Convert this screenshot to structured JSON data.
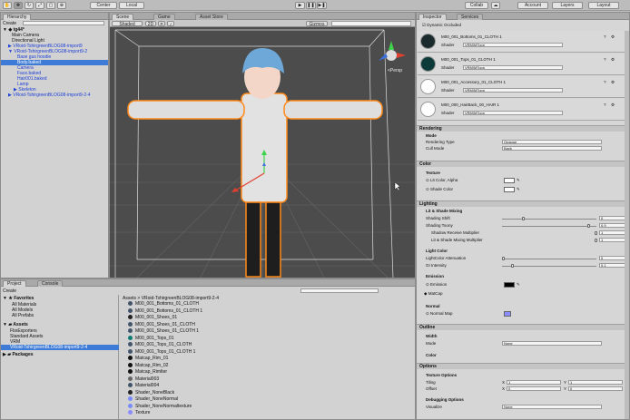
{
  "toolbar": {
    "center": "Center",
    "local": "Local",
    "collab": "Collab",
    "account": "Account",
    "layers": "Layers",
    "layout": "Layout"
  },
  "hierarchy": {
    "tab": "Hierarchy",
    "create": "Create",
    "root": "tg44*",
    "items": [
      "Main Camera",
      "Directional Light",
      "VRoid-TshirgreenBLOG08-import9",
      "VRoid-TshirgreenBLOG08-import9-2",
      "Base gus hoodie",
      "Body.baked",
      "Camera",
      "Face.baked",
      "Hair001.baked",
      "Lamp",
      "Skeleton",
      "VRoid-TshirgreenBLOG08-import9-2-4"
    ]
  },
  "scene": {
    "tabs": [
      "Scene",
      "Game",
      "Asset Store"
    ],
    "shaded": "Shaded",
    "mode2d": "2D",
    "gizmos": "Gizmos",
    "persp": "<Persp"
  },
  "project": {
    "tabs": [
      "Project",
      "Console"
    ],
    "create": "Create",
    "favorites": "Favorites",
    "fav_items": [
      "All Materials",
      "All Models",
      "All Prefabs"
    ],
    "assets": "Assets",
    "asset_items": [
      "FbxExporters",
      "Standard Assets",
      "VRM",
      "VRoid-TshirgreenBLOG08-import9-2-4"
    ],
    "packages": "Packages",
    "breadcrumb": "Assets > VRoid-TshirgreenBLOG08-import9-2-4",
    "files": [
      "M00_001_Bottoms_01_CLOTH",
      "M00_001_Bottoms_01_CLOTH 1",
      "M00_001_Shoes_01",
      "M00_001_Shoes_01_CLOTH",
      "M00_001_Shoes_01_CLOTH 1",
      "M00_001_Tops_01",
      "M00_001_Tops_01_CLOTH",
      "M00_001_Tops_01_CLOTH 1",
      "Matcap_Rim_01",
      "Matcap_Rim_02",
      "Matcap_Rimlter",
      "Material003",
      "Material004",
      "Shader_NoneBlack",
      "Shader_NoneNormal",
      "Shader_NoneNormaltexture",
      "Texture"
    ]
  },
  "inspector": {
    "tabs": [
      "Inspector",
      "Services"
    ],
    "dynamic_occluded": "Dynamic Occluded",
    "materials": [
      {
        "name": "M00_001_Bottoms_01_CLOTH 1",
        "shader": "VRM/MToon"
      },
      {
        "name": "M00_001_Tops_01_CLOTH 1",
        "shader": "VRM/MToon"
      },
      {
        "name": "M00_001_Accessory_01_CLOTH 1",
        "shader": "VRM/MToon"
      },
      {
        "name": "M00_000_HairBack_00_HAIR 1",
        "shader": "VRM/MToon"
      }
    ],
    "shader_label": "Shader",
    "rendering": "Rendering",
    "mode": "Mode",
    "rendering_type": "Rendering Type",
    "rendering_type_val": "Opaque",
    "cull_mode": "Cull Mode",
    "cull_mode_val": "Back",
    "color": "Color",
    "texture": "Texture",
    "lit_color": "Lit Color, Alpha",
    "shade_color": "Shade Color",
    "lighting": "Lighting",
    "lit_shade": "Lit & Shade Mixing",
    "shading_shift": "Shading Shift",
    "shading_shift_val": "0",
    "shading_toony": "Shading Toony",
    "shading_toony_val": "0.9",
    "shadow_recv": "Shadow Receive Multiplier",
    "shadow_recv_val": "1",
    "lit_mix": "Lit & Shade Mixing Multiplier",
    "lit_mix_val": "1",
    "light_color": "Light Color",
    "lc_atten": "LightColor Attenuation",
    "lc_atten_val": "0",
    "gi": "GI Intensity",
    "gi_val": "0.1",
    "emission": "Emission",
    "emission_lbl": "Emission",
    "matcap": "MatCap",
    "normal": "Normal",
    "normal_map": "Normal Map",
    "outline": "Outline",
    "width": "Width",
    "mode2": "Mode",
    "mode2_val": "None",
    "color2": "Color",
    "options": "Options",
    "tex_options": "Texture Options",
    "tiling": "Tiling",
    "offset": "Offset",
    "x": "X",
    "y": "Y",
    "tx": "1",
    "ty": "1",
    "ox": "0",
    "oy": "0",
    "debug": "Debugging Options",
    "visualize": "Visualize",
    "visualize_val": "None"
  }
}
